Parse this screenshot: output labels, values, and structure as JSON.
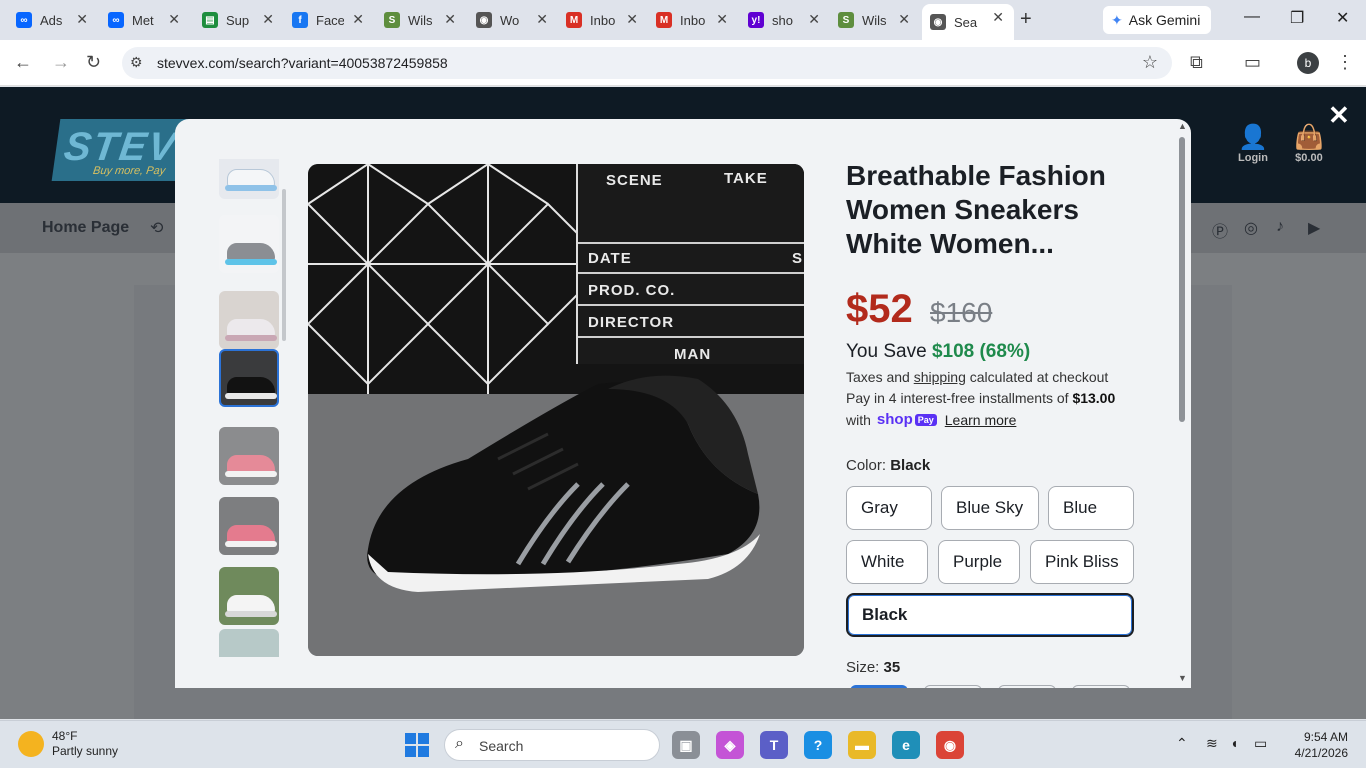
{
  "browser": {
    "tabs": [
      {
        "label": "Ads",
        "favicon": "meta-icon",
        "color": "#0866ff",
        "glyph": "∞"
      },
      {
        "label": "Met",
        "favicon": "meta-icon",
        "color": "#0866ff",
        "glyph": "∞"
      },
      {
        "label": "Sup",
        "favicon": "sheet-icon",
        "color": "#1e8e3e",
        "glyph": "▤"
      },
      {
        "label": "Face",
        "favicon": "facebook-icon",
        "color": "#1877f2",
        "glyph": "f"
      },
      {
        "label": "Wils",
        "favicon": "shopify-icon",
        "color": "#5e8e3e",
        "glyph": "S"
      },
      {
        "label": "Wo",
        "favicon": "globe-icon",
        "color": "#555555",
        "glyph": "◉"
      },
      {
        "label": "Inbo",
        "favicon": "gmail-icon",
        "color": "#d93025",
        "glyph": "M"
      },
      {
        "label": "Inbo",
        "favicon": "gmail-icon",
        "color": "#d93025",
        "glyph": "M"
      },
      {
        "label": "sho",
        "favicon": "yahoo-icon",
        "color": "#6001d2",
        "glyph": "y!"
      },
      {
        "label": "Wils",
        "favicon": "shopify-icon",
        "color": "#5e8e3e",
        "glyph": "S"
      },
      {
        "label": "Sea",
        "favicon": "globe-icon",
        "color": "#555555",
        "glyph": "◉",
        "active": true
      }
    ],
    "gemini_label": "Ask Gemini",
    "url": "stevvex.com/search?variant=40053872459858",
    "profile_initial": "b"
  },
  "site": {
    "logo_text": "STEVVEX",
    "logo_slogan": "Buy more, Pay",
    "login_label": "Login",
    "cart_label": "$0.00",
    "nav_home": "Home Page"
  },
  "product": {
    "title": "Breathable Fashion Women Sneakers White Women...",
    "price": "$52",
    "compare_price": "$160",
    "save_label": "You Save",
    "save_amount": "$108 (68%)",
    "tax_prefix": "Taxes and",
    "tax_link": "shipping",
    "tax_suffix": "calculated at checkout",
    "install_text": "Pay in 4 interest-free installments of",
    "install_amount": "$13.00",
    "with_label": "with",
    "shop_label": "shop",
    "pay_label": "Pay",
    "learn_more": "Learn more",
    "color_label": "Color:",
    "color_value": "Black",
    "colors": [
      "Gray",
      "Blue Sky",
      "Blue",
      "White",
      "Purple",
      "Pink Bliss",
      "Black"
    ],
    "selected_color": "Black",
    "size_label": "Size:",
    "size_value": "35",
    "image_board": {
      "scene": "SCENE",
      "take": "TAKE",
      "date": "DATE",
      "prod": "PROD. CO.",
      "director": "DIRECTOR",
      "cam": "MAN",
      "s": "S"
    }
  },
  "taskbar": {
    "temp": "48°F",
    "weather": "Partly sunny",
    "search_placeholder": "Search",
    "time": "9:54 AM",
    "date": "4/21/2026"
  }
}
